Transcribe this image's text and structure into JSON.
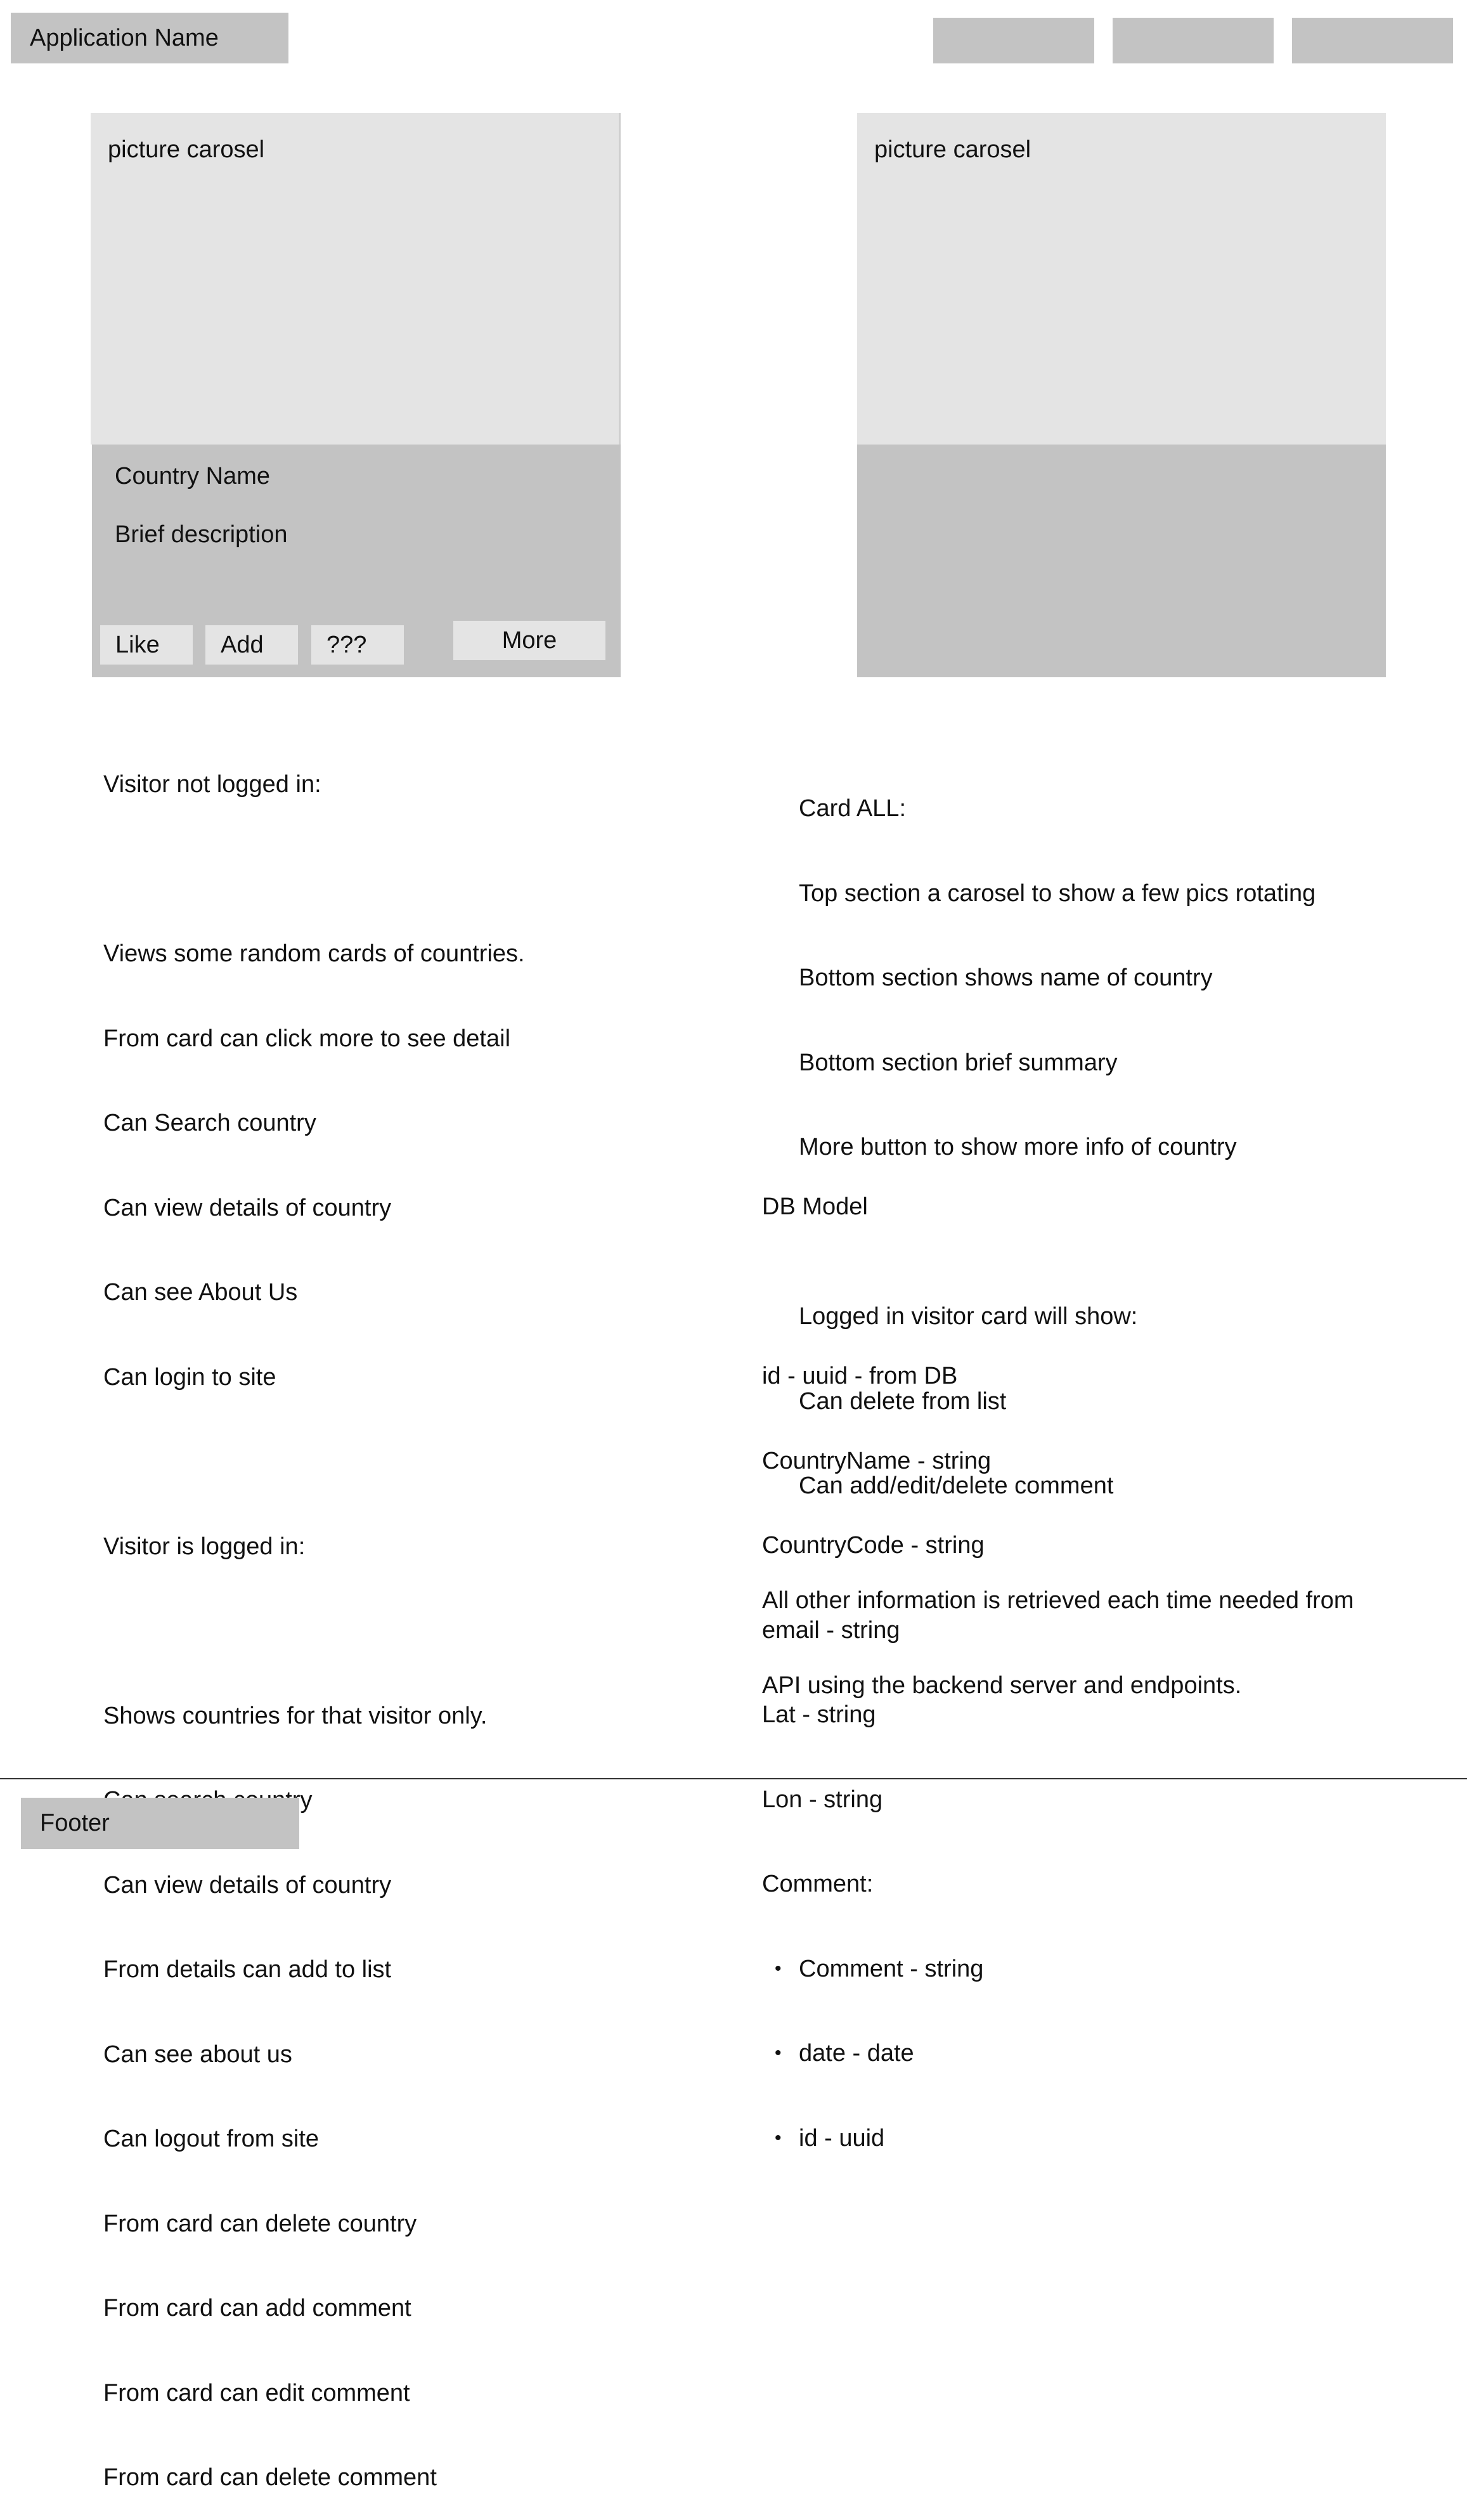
{
  "header": {
    "app_name": "Application Name",
    "nav_buttons": [
      "",
      "",
      ""
    ]
  },
  "cards": {
    "left": {
      "carousel_label": "picture carosel",
      "country_name": "Country Name",
      "brief_description": "Brief description",
      "buttons": {
        "like": "Like",
        "add": "Add",
        "unknown": "???",
        "more": "More"
      }
    },
    "right": {
      "carousel_label": "picture carosel"
    }
  },
  "notes": {
    "not_logged_in": {
      "heading": "Visitor not logged in:",
      "items": [
        "Views some random cards of countries.",
        "From card can click more to see detail",
        "Can Search country",
        "Can view details of country",
        "Can see About Us",
        "Can login to site"
      ]
    },
    "logged_in": {
      "heading": "Visitor is logged in:",
      "items": [
        "Shows countries for that visitor only.",
        "Can search country",
        "Can view details of country",
        "From details can add to list",
        "Can see about us",
        "Can logout from site",
        "From card can delete country",
        "From card can add comment",
        "From card can edit comment",
        "From card can delete comment"
      ]
    },
    "card_all": {
      "items": [
        "Card ALL:",
        "Top section a carosel to show a few pics rotating",
        "Bottom section shows name of country",
        "Bottom section brief summary",
        "More button to show more info of country"
      ]
    },
    "logged_in_card": {
      "items": [
        "Logged in visitor card will show:",
        "Can delete from list",
        "Can add/edit/delete comment"
      ]
    },
    "db_model": {
      "heading": "DB Model",
      "fields": [
        "id - uuid - from DB",
        "CountryName - string",
        "CountryCode - string",
        "email - string",
        "Lat - string",
        "Lon - string",
        "Comment:"
      ],
      "comment_fields": [
        "Comment - string",
        "date - date",
        "id - uuid"
      ]
    },
    "api": {
      "lines": [
        "All other information is retrieved each time needed from",
        "API using the backend server and endpoints."
      ]
    }
  },
  "footer": {
    "label": "Footer"
  }
}
